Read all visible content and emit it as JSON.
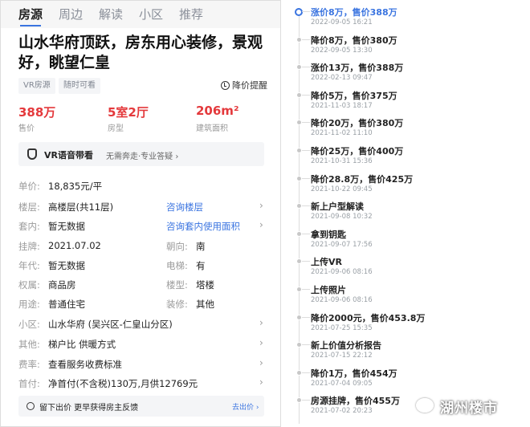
{
  "tabs": [
    "房源",
    "周边",
    "解读",
    "小区",
    "推荐"
  ],
  "listing": {
    "title": "山水华府顶跃，房东用心装修，景观好，眺望仁皇",
    "tags": [
      "VR房源",
      "随时可看"
    ],
    "price_alert": "降价提醒",
    "kpis": [
      {
        "value": "388万",
        "label": "售价"
      },
      {
        "value": "5室2厅",
        "label": "房型"
      },
      {
        "value": "206m²",
        "label": "建筑面积"
      }
    ],
    "vr_banner": {
      "title": "VR语音带看",
      "subtitle": "无需奔走·专业答疑 ›"
    },
    "details": [
      {
        "label": "单价:",
        "value": "18,835元/平"
      },
      {
        "label": "楼层:",
        "value": "高楼层(共11层)",
        "link": "咨询楼层"
      },
      {
        "label": "套内:",
        "value": "暂无数据",
        "link": "咨询套内使用面积"
      },
      {
        "label": "挂牌:",
        "value": "2021.07.02",
        "label2": "朝向:",
        "value2": "南"
      },
      {
        "label": "年代:",
        "value": "暂无数据",
        "label2": "电梯:",
        "value2": "有"
      },
      {
        "label": "权属:",
        "value": "商品房",
        "label2": "楼型:",
        "value2": "塔楼"
      },
      {
        "label": "用途:",
        "value": "普通住宅",
        "label2": "装修:",
        "value2": "其他"
      },
      {
        "label": "小区:",
        "value": "山水华府 (吴兴区-仁皇山分区)"
      },
      {
        "label": "其他:",
        "value": "梯户比 供暖方式"
      },
      {
        "label": "费率:",
        "value": "查看服务收费标准"
      },
      {
        "label": "首付:",
        "value": "净首付(不含税)130万,月供12769元"
      }
    ],
    "footer": {
      "text": "留下出价 更早获得房主反馈",
      "link": "去出价 ›"
    }
  },
  "timeline": [
    {
      "text": "涨价8万，售价388万",
      "date": "2022-09-05 16:21"
    },
    {
      "text": "降价8万，售价380万",
      "date": "2022-09-05 13:30"
    },
    {
      "text": "涨价13万，售价388万",
      "date": "2022-02-13 09:47"
    },
    {
      "text": "降价5万，售价375万",
      "date": "2021-11-03 18:17"
    },
    {
      "text": "降价20万，售价380万",
      "date": "2021-11-02 11:10"
    },
    {
      "text": "降价25万，售价400万",
      "date": "2021-10-31 15:36"
    },
    {
      "text": "降价28.8万，售价425万",
      "date": "2021-10-22 09:45"
    },
    {
      "text": "新上户型解读",
      "date": "2021-09-08 10:32"
    },
    {
      "text": "拿到钥匙",
      "date": "2021-09-07 17:56"
    },
    {
      "text": "上传VR",
      "date": "2021-09-06 08:16"
    },
    {
      "text": "上传照片",
      "date": "2021-09-06 08:16"
    },
    {
      "text": "降价2000元，售价453.8万",
      "date": "2021-07-25 15:35"
    },
    {
      "text": "新上价值分析报告",
      "date": "2021-07-15 22:12"
    },
    {
      "text": "降价1万，售价454万",
      "date": "2021-07-04 09:05"
    },
    {
      "text": "房源挂牌，售价455万",
      "date": "2021-07-02 20:23"
    }
  ],
  "watermark": "湖州楼市"
}
